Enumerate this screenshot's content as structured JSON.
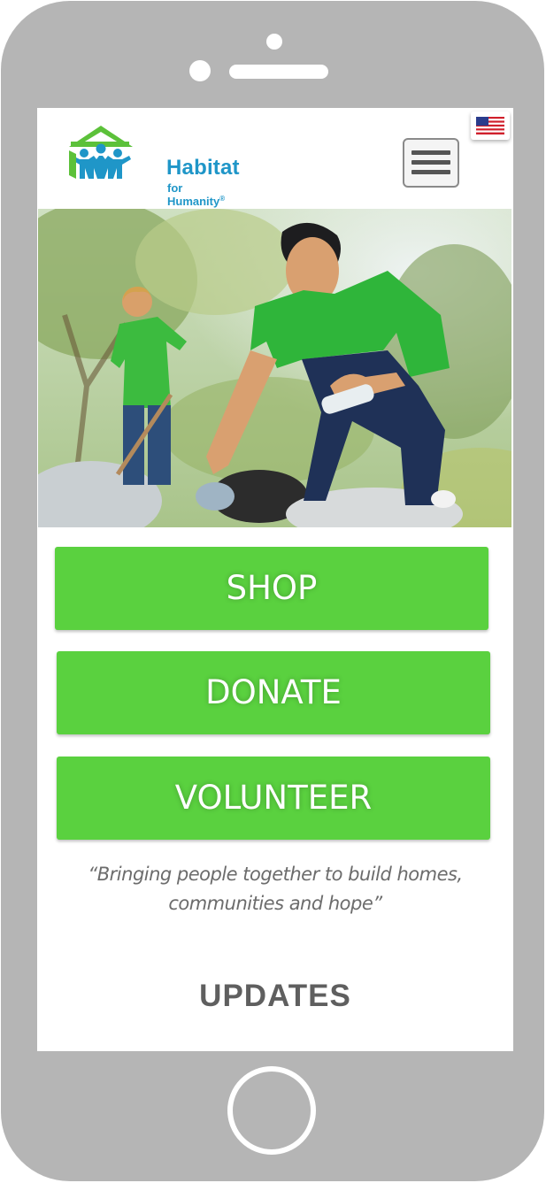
{
  "header": {
    "logo_line1": "Habitat",
    "logo_line2": "for Humanity",
    "logo_trademark": "®",
    "menu_icon": "hamburger-menu-icon",
    "language_flag": "us-flag-icon"
  },
  "hero": {
    "image": "volunteers-cleaning-up-trash-photo"
  },
  "actions": {
    "shop_label": "SHOP",
    "donate_label": "DONATE",
    "volunteer_label": "VOLUNTEER"
  },
  "tagline": {
    "line1": "“Bringing people together to build homes,",
    "line2": "communities and hope”"
  },
  "updates": {
    "heading": "UPDATES"
  },
  "colors": {
    "button_green": "#5ad13f",
    "logo_blue": "#1f96c8",
    "logo_green": "#5cc13a",
    "phone_frame": "#b5b5b5"
  }
}
